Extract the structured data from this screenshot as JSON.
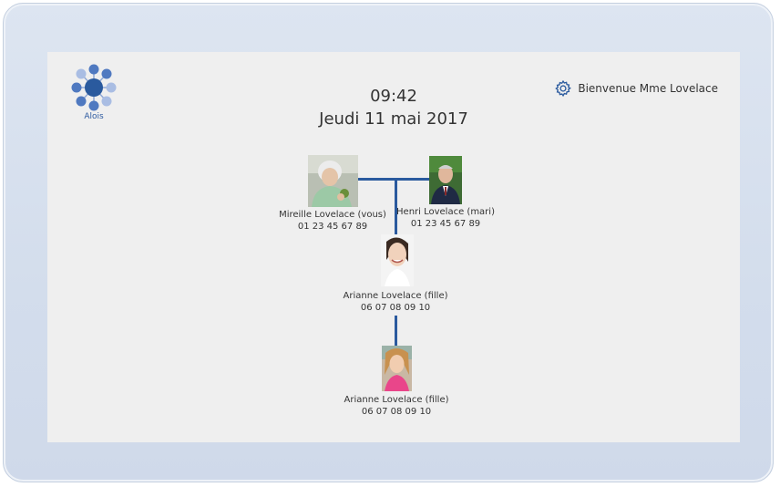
{
  "app": {
    "logo_text": "Alois",
    "time": "09:42",
    "date": "Jeudi 11 mai 2017",
    "welcome": "Bienvenue Mme Lovelace",
    "accent_color": "#2a5a9e"
  },
  "family": {
    "self": {
      "name": "Mireille Lovelace (vous)",
      "phone": "01 23 45 67 89"
    },
    "spouse": {
      "name": "Henri Lovelace (mari)",
      "phone": "01 23 45 67 89"
    },
    "daughter": {
      "name": "Arianne Lovelace (fille)",
      "phone": "06 07 08 09 10"
    },
    "granddaughter": {
      "name": "Arianne Lovelace (fille)",
      "phone": "06 07 08 09 10"
    }
  },
  "icons": {
    "logo": "alois-network-logo",
    "settings": "gear-icon"
  }
}
